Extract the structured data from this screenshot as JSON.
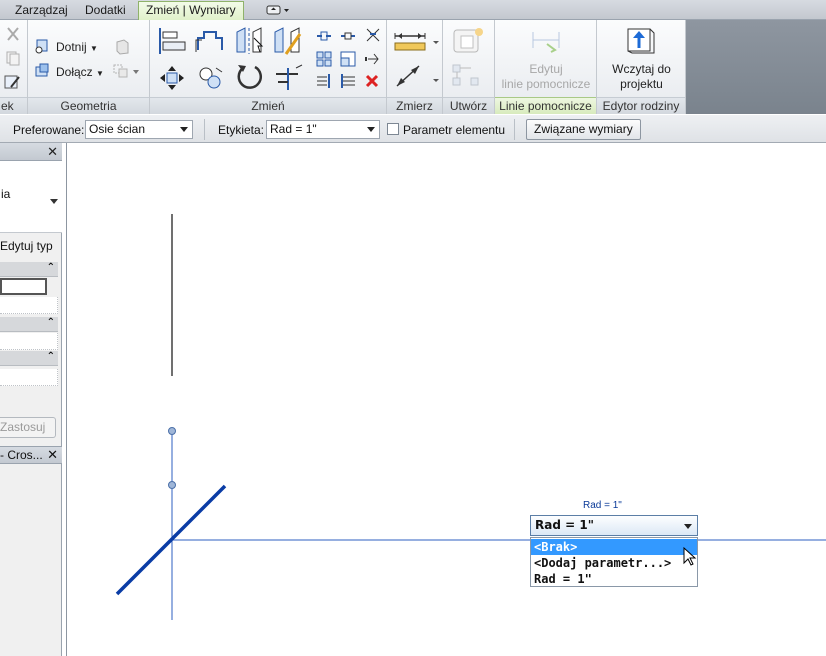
{
  "tabs": [
    {
      "label": "Zarządzaj",
      "active": false
    },
    {
      "label": "Dodatki",
      "active": false
    },
    {
      "label": "Zmień | Wymiary",
      "active": true
    }
  ],
  "ribbon": {
    "panels": {
      "partial_left": "ek",
      "geometry": "Geometria",
      "modify": "Zmień",
      "measure": "Zmierz",
      "create": "Utwórz",
      "ref_lines": "Linie pomocnicze",
      "family_editor": "Edytor rodziny"
    },
    "geometry_buttons": {
      "cut": "Dotnij",
      "join": "Dołącz"
    },
    "edit_ref_lines": {
      "line1": "Edytuj",
      "line2": "linie pomocnicze"
    },
    "load_project": {
      "line1": "Wczytaj do",
      "line2": "projektu"
    }
  },
  "options_bar": {
    "preferred_label": "Preferowane:",
    "preferred_value": "Osie ścian",
    "label_label": "Etykieta:",
    "label_value": "Rad = 1\"",
    "param_checkbox": "Parametr elementu",
    "linked_button": "Związane wymiary"
  },
  "properties": {
    "type_partial": "ia",
    "edit_type": "Edytuj typ",
    "apply": "Zastosuj",
    "browser_partial": "- Cros..."
  },
  "canvas": {
    "dim_text": "Rad = 1\"",
    "label_combo_value": "Rad = 1\"",
    "label_options": [
      "<Brak>",
      "<Dodaj parametr...>",
      "Rad = 1\""
    ],
    "selected_option_index": 0,
    "colors": {
      "line_blue": "#1f4fb5",
      "thick_blue": "#0a3ca5",
      "axis": "#2d5fc0"
    }
  }
}
